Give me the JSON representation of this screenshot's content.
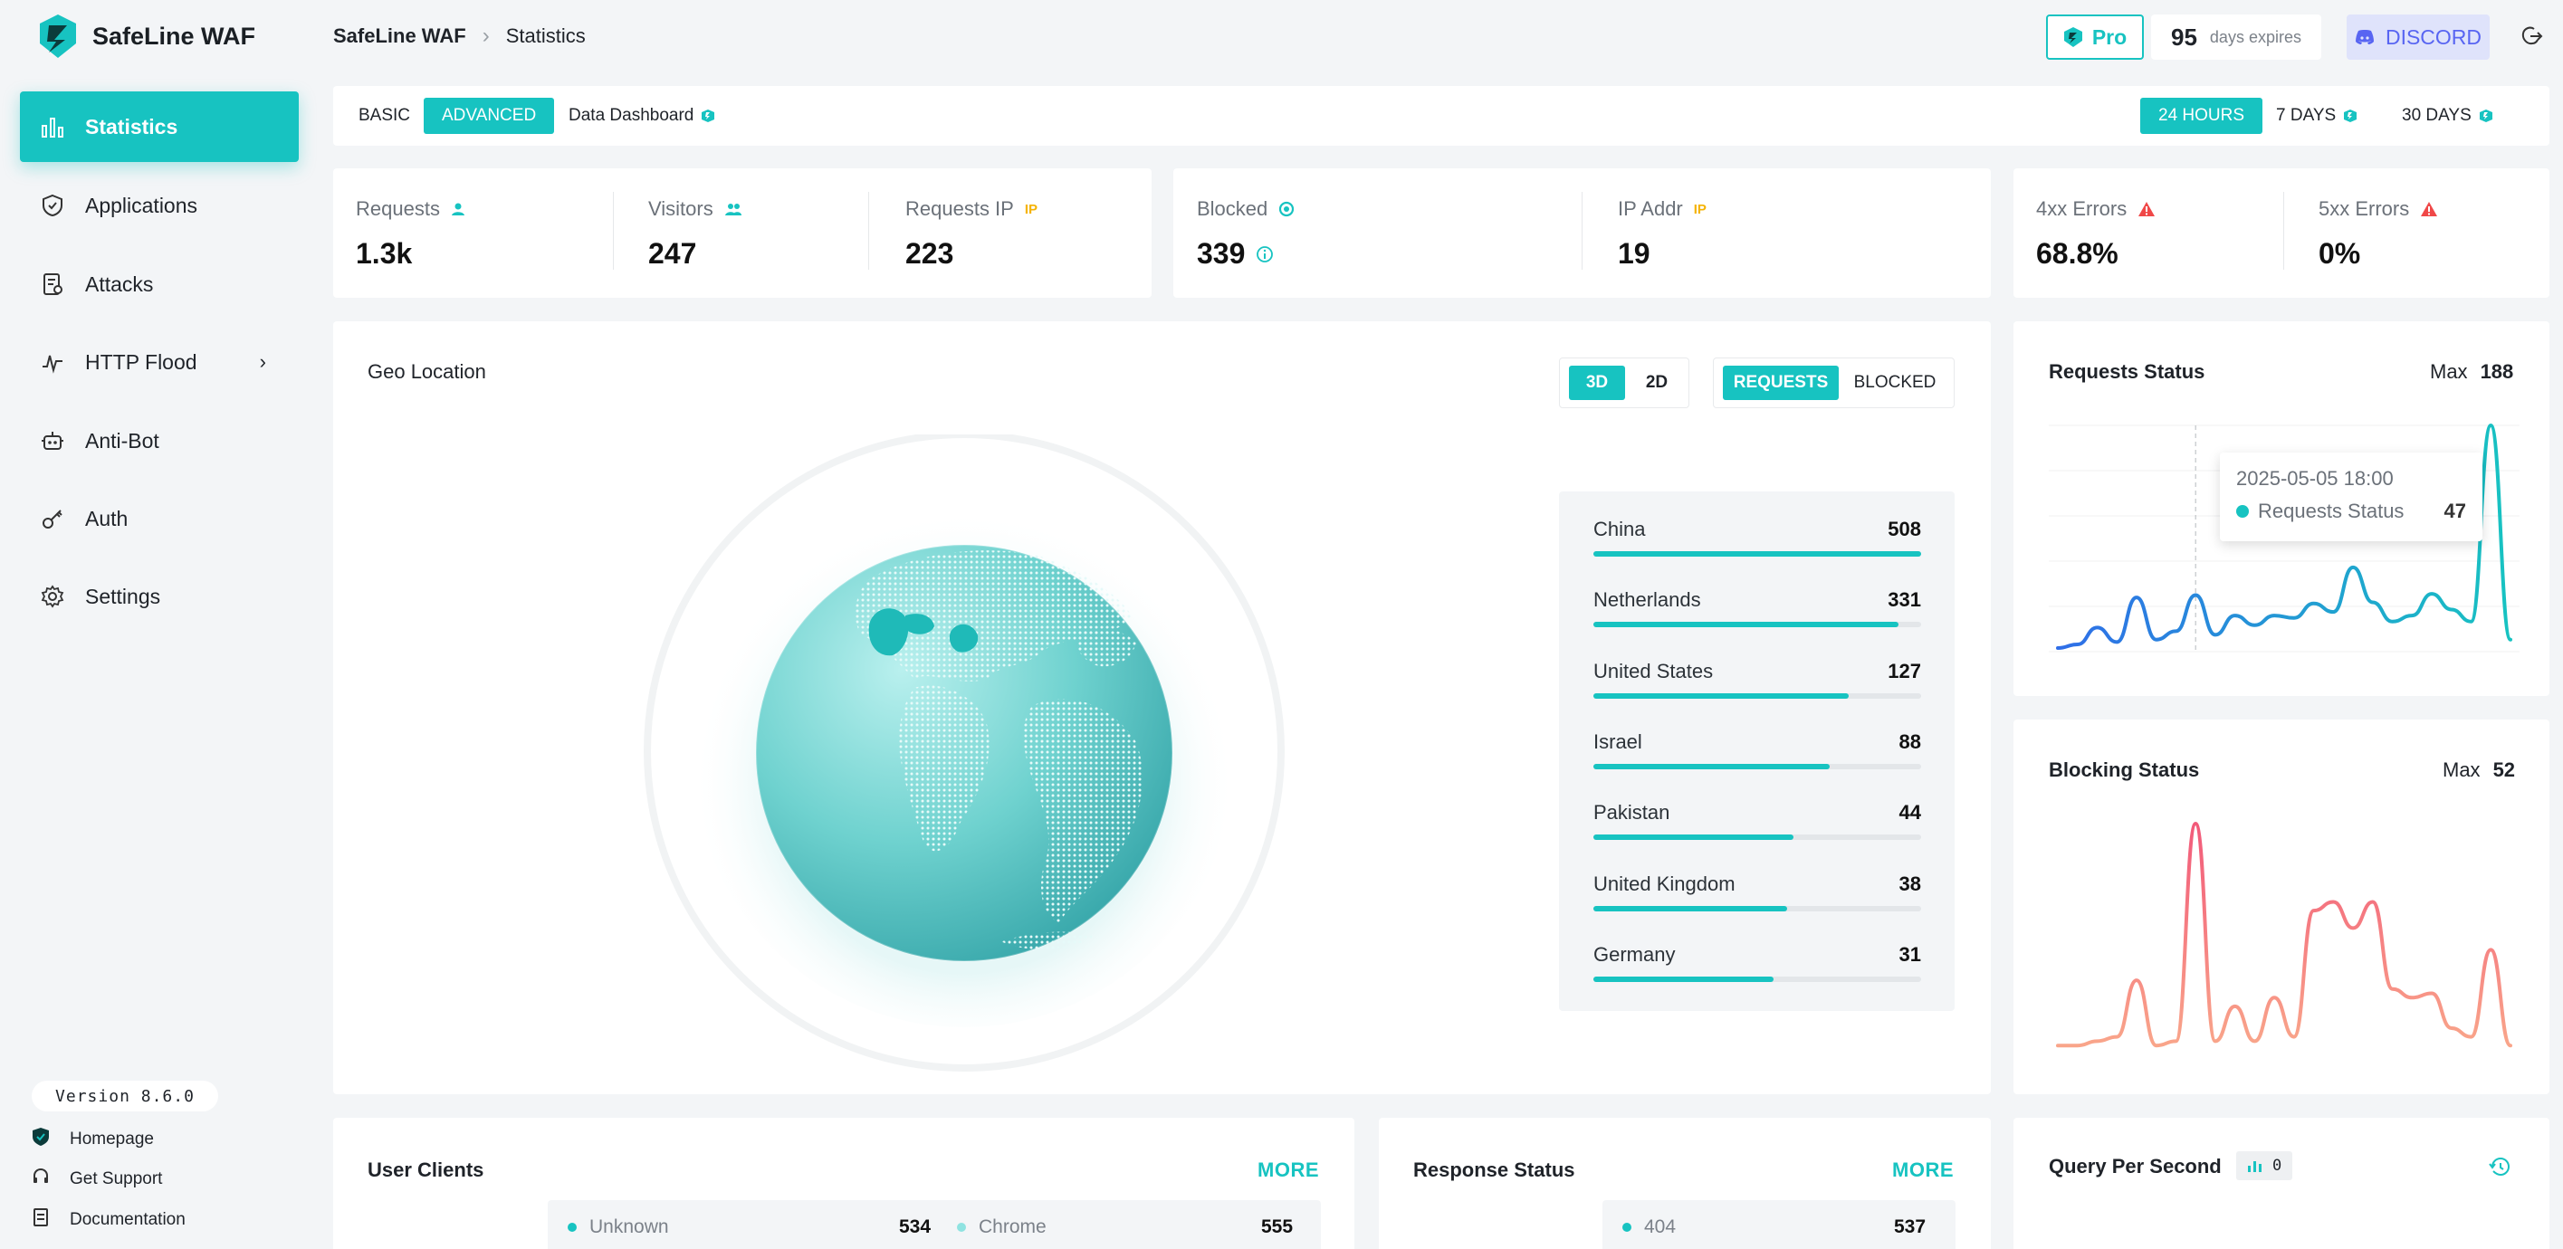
{
  "app": {
    "name": "SafeLine WAF",
    "version": "Version 8.6.0"
  },
  "breadcrumb": {
    "root": "SafeLine WAF",
    "current": "Statistics"
  },
  "header": {
    "pro_label": "Pro",
    "expire_days": "95",
    "expire_text": "days expires",
    "discord_label": "DISCORD"
  },
  "sidebar": {
    "items": [
      {
        "label": "Statistics",
        "icon": "bar-chart-icon"
      },
      {
        "label": "Applications",
        "icon": "shield-icon"
      },
      {
        "label": "Attacks",
        "icon": "document-icon"
      },
      {
        "label": "HTTP Flood",
        "icon": "pulse-icon"
      },
      {
        "label": "Anti-Bot",
        "icon": "robot-icon"
      },
      {
        "label": "Auth",
        "icon": "key-icon"
      },
      {
        "label": "Settings",
        "icon": "gear-icon"
      }
    ],
    "footer": [
      {
        "label": "Homepage",
        "icon": "shield-icon"
      },
      {
        "label": "Get Support",
        "icon": "headset-icon"
      },
      {
        "label": "Documentation",
        "icon": "document-icon"
      }
    ]
  },
  "tabs": {
    "basic": "BASIC",
    "advanced": "ADVANCED",
    "dashboard": "Data Dashboard",
    "range_24h": "24 HOURS",
    "range_7d": "7 DAYS",
    "range_30d": "30 DAYS"
  },
  "stats": {
    "requests": {
      "label": "Requests",
      "value": "1.3k"
    },
    "visitors": {
      "label": "Visitors",
      "value": "247"
    },
    "requests_ip": {
      "label": "Requests IP",
      "value": "223",
      "tag": "IP"
    },
    "blocked": {
      "label": "Blocked",
      "value": "339"
    },
    "ip_addr": {
      "label": "IP Addr",
      "value": "19",
      "tag": "IP"
    },
    "err4xx": {
      "label": "4xx Errors",
      "value": "68.8%"
    },
    "err5xx": {
      "label": "5xx Errors",
      "value": "0%"
    }
  },
  "geo": {
    "title": "Geo Location",
    "btn_3d": "3D",
    "btn_2d": "2D",
    "btn_requests": "REQUESTS",
    "btn_blocked": "BLOCKED",
    "countries": [
      {
        "name": "China",
        "value": 508
      },
      {
        "name": "Netherlands",
        "value": 331
      },
      {
        "name": "United States",
        "value": 127
      },
      {
        "name": "Israel",
        "value": 88
      },
      {
        "name": "Pakistan",
        "value": 44
      },
      {
        "name": "United Kingdom",
        "value": 38
      },
      {
        "name": "Germany",
        "value": 31
      }
    ],
    "bar_fractions": [
      1.0,
      0.93,
      0.78,
      0.72,
      0.61,
      0.59,
      0.55
    ]
  },
  "requests_status": {
    "title": "Requests Status",
    "max_label": "Max",
    "max_value": "188",
    "tooltip_time": "2025-05-05 18:00",
    "tooltip_series": "Requests Status",
    "tooltip_value": "47"
  },
  "blocking_status": {
    "title": "Blocking Status",
    "max_label": "Max",
    "max_value": "52"
  },
  "user_clients": {
    "title": "User Clients",
    "more": "MORE",
    "items": [
      {
        "label": "Unknown",
        "value": "534"
      },
      {
        "label": "Chrome",
        "value": "555"
      }
    ]
  },
  "response_status": {
    "title": "Response Status",
    "more": "MORE",
    "items": [
      {
        "label": "404",
        "value": "537"
      }
    ]
  },
  "qps": {
    "title": "Query Per Second",
    "value": "0"
  },
  "chart_data": [
    {
      "type": "line",
      "title": "Requests Status",
      "x": [
        0,
        1,
        2,
        3,
        4,
        5,
        6,
        7,
        8,
        9,
        10,
        11,
        12,
        13,
        14,
        15,
        16,
        17,
        18,
        19,
        20,
        21,
        22,
        23
      ],
      "values": [
        3,
        6,
        20,
        8,
        45,
        10,
        17,
        47,
        14,
        30,
        22,
        30,
        28,
        40,
        33,
        70,
        41,
        25,
        30,
        48,
        35,
        25,
        188,
        10
      ],
      "ylim": [
        0,
        188
      ]
    },
    {
      "type": "line",
      "title": "Blocking Status",
      "x": [
        0,
        1,
        2,
        3,
        4,
        5,
        6,
        7,
        8,
        9,
        10,
        11,
        12,
        13,
        14,
        15,
        16,
        17,
        18,
        19,
        20,
        21,
        22,
        23
      ],
      "values": [
        1,
        1,
        2,
        3,
        16,
        1,
        2,
        52,
        2,
        10,
        2,
        12,
        3,
        32,
        34,
        28,
        34,
        14,
        12,
        13,
        5,
        3,
        23,
        1
      ],
      "ylim": [
        0,
        52
      ]
    }
  ],
  "colors": {
    "accent": "#17c3c1",
    "warn": "#f5b301",
    "danger": "#f04848",
    "discord": "#5865f2"
  }
}
